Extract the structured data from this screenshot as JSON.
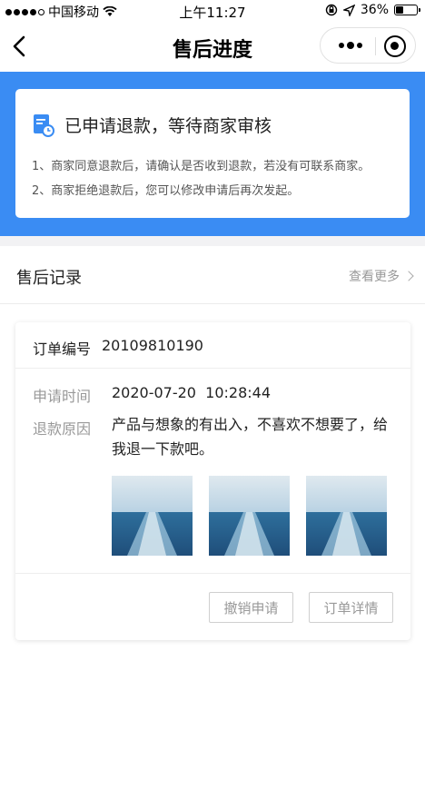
{
  "status_bar": {
    "carrier": "中国移动",
    "time": "上午11:27",
    "battery": "36%",
    "battery_level": 0.36
  },
  "nav": {
    "title": "售后进度",
    "back_icon": "chevron-left-icon",
    "more_icon": "more-dots-icon",
    "close_icon": "target-circle-icon"
  },
  "notice": {
    "title": "已申请退款，等待商家审核",
    "lines": [
      "1、商家同意退款后，请确认是否收到退款，若没有可联系商家。",
      "2、商家拒绝退款后，您可以修改申请后再次发起。"
    ],
    "icon": "document-clock-icon"
  },
  "records": {
    "title": "售后记录",
    "view_more": "查看更多"
  },
  "order": {
    "order_no_label": "订单编号",
    "order_no": "20109810190",
    "apply_time_label": "申请时间",
    "apply_time": "2020-07-20  10:28:44",
    "reason_label": "退款原因",
    "reason": "产品与想象的有出入，不喜欢不想要了，给我退一下款吧。",
    "images": [
      "ocean-wake-image",
      "ocean-wake-image",
      "ocean-wake-image"
    ],
    "cancel_button": "撤销申请",
    "detail_button": "订单详情"
  },
  "colors": {
    "banner": "#3a8cf3",
    "icon_blue": "#3a8cf3"
  }
}
